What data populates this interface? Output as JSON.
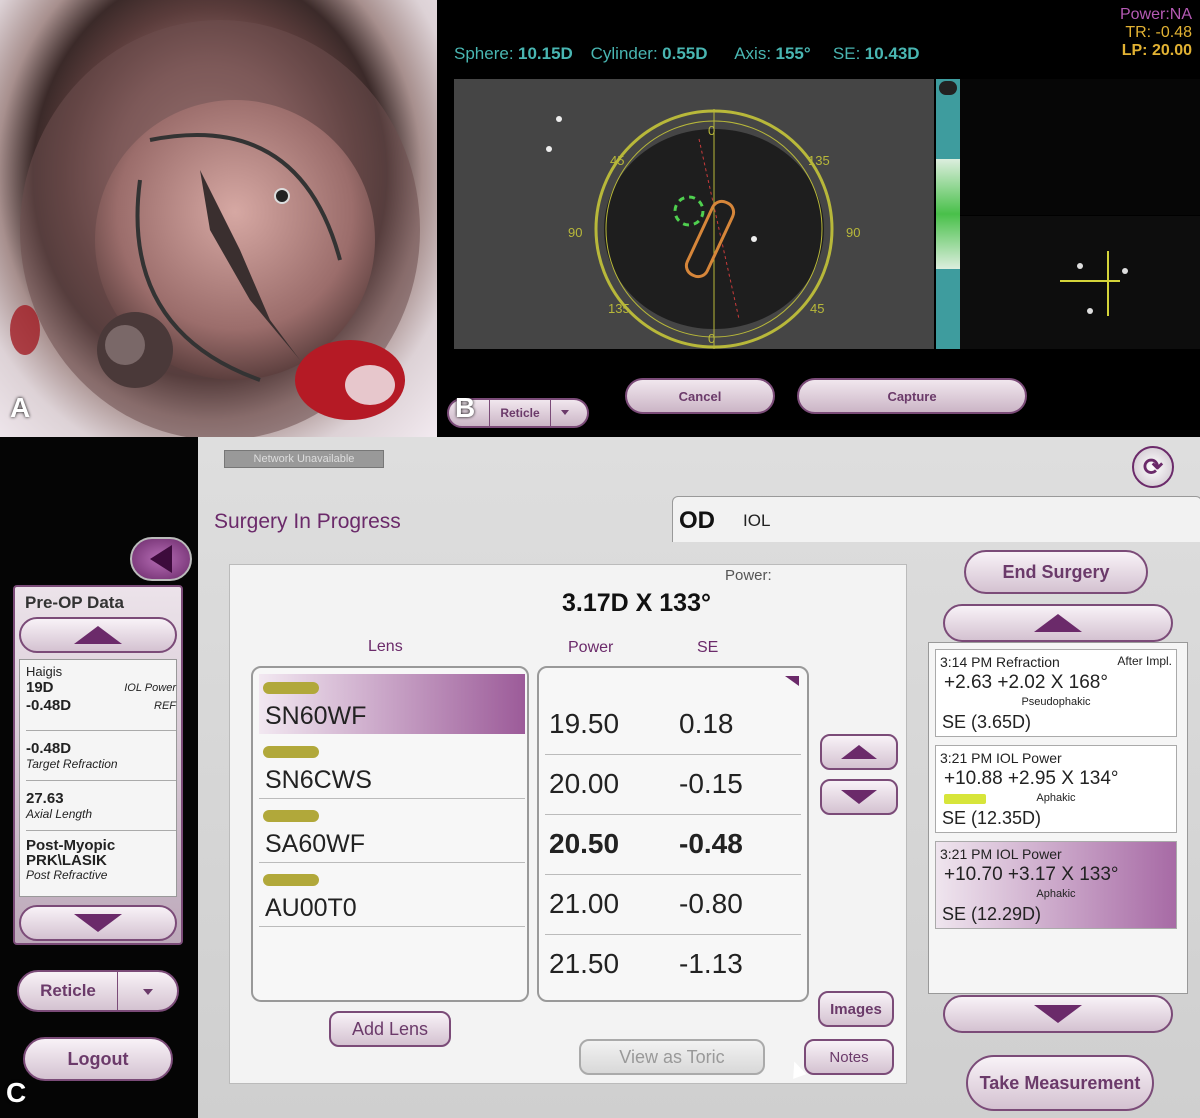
{
  "panel_letters": {
    "a": "A",
    "b": "B",
    "c": "C"
  },
  "panelB": {
    "power": "Power:NA",
    "tr": "TR: -0.48",
    "lp": "LP: 20.00",
    "sphere_label": "Sphere:",
    "sphere_value": "10.15D",
    "cylinder_label": "Cylinder:",
    "cylinder_value": "0.55D",
    "axis_label": "Axis:",
    "axis_value": "155°",
    "se_label": "SE:",
    "se_value": "10.43D",
    "reticle_ticks": [
      "0",
      "45",
      "135",
      "90",
      "90",
      "135",
      "45",
      "0"
    ],
    "reticle_label": "Reticle",
    "cancel_label": "Cancel",
    "capture_label": "Capture"
  },
  "panelC": {
    "network_status": "Network Unavailable",
    "page_title": "Surgery In Progress",
    "eye": "OD",
    "eye_mode": "IOL",
    "preop": {
      "title": "Pre-OP Data",
      "formula": "Haigis",
      "iol_power": "19D",
      "iol_power_label": "IOL Power",
      "ref_value": "-0.48D",
      "ref_label": "REF",
      "target_value": "-0.48D",
      "target_label": "Target Refraction",
      "axial_value": "27.63",
      "axial_label": "Axial Length",
      "post_value": "Post-Myopic PRK\\LASIK",
      "post_label": "Post Refractive"
    },
    "reticle_label": "Reticle",
    "logout_label": "Logout",
    "power_label": "Power:",
    "power_value": "3.17D X 133°",
    "lens_header": "Lens",
    "power_header": "Power",
    "se_header": "SE",
    "lenses": [
      "SN60WF",
      "SN6CWS",
      "SA60WF",
      "AU00T0"
    ],
    "powers": [
      {
        "power": "19.50",
        "se": "0.18"
      },
      {
        "power": "20.00",
        "se": "-0.15"
      },
      {
        "power": "20.50",
        "se": "-0.48"
      },
      {
        "power": "21.00",
        "se": "-0.80"
      },
      {
        "power": "21.50",
        "se": "-1.13"
      }
    ],
    "add_lens_label": "Add Lens",
    "view_toric_label": "View as Toric",
    "images_label": "Images",
    "notes_label": "Notes",
    "end_surgery_label": "End Surgery",
    "take_measurement_label": "Take Measurement",
    "history": [
      {
        "time": "3:14 PM Refraction",
        "tag": "After Impl.",
        "values": "+2.63  +2.02 X 168°",
        "status": "Pseudophakic",
        "se": "SE (3.65D)"
      },
      {
        "time": "3:21 PM IOL Power",
        "tag": "",
        "values": "+10.88  +2.95 X 134°",
        "status": "Aphakic",
        "se": "SE (12.35D)"
      },
      {
        "time": "3:21 PM IOL Power",
        "tag": "",
        "values": "+10.70  +3.17 X 133°",
        "status": "Aphakic",
        "se": "SE (12.29D)"
      }
    ]
  },
  "colors": {
    "accent": "#6b2a6a",
    "teal": "#49b6b2",
    "yellow": "#e2b233",
    "reticle": "#b8b83a"
  }
}
